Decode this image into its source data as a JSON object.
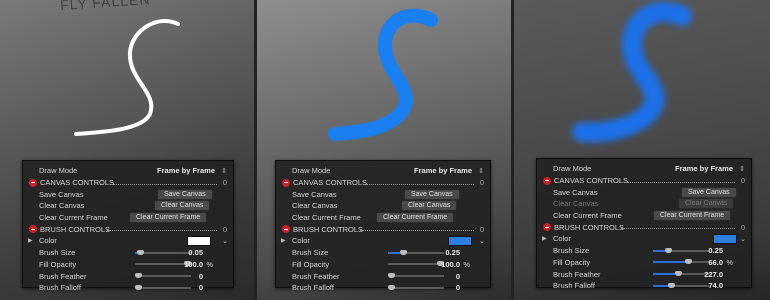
{
  "background": {
    "text": "FLY FALLEN"
  },
  "panels": [
    {
      "stroke_color": "#ffffff",
      "controls": {
        "draw_mode": {
          "label": "Draw Mode",
          "value": "Frame by Frame"
        },
        "canvas_section": {
          "label": "CANVAS CONTROLS",
          "value": "0"
        },
        "save_canvas": {
          "label": "Save Canvas",
          "button": "Save Canvas"
        },
        "clear_canvas": {
          "label": "Clear Canvas",
          "button": "Clear Canvas"
        },
        "clear_frame": {
          "label": "Clear Current Frame",
          "button": "Clear Current Frame"
        },
        "brush_section": {
          "label": "BRUSH CONTROLS",
          "value": "0"
        },
        "color": {
          "label": "Color",
          "value": "#ffffff"
        },
        "brush_size": {
          "label": "Brush Size",
          "value": "0.05"
        },
        "fill_opacity": {
          "label": "Fill Opacity",
          "value": "100.0",
          "unit": "%"
        },
        "brush_feather": {
          "label": "Brush Feather",
          "value": "0"
        },
        "brush_falloff": {
          "label": "Brush Falloff",
          "value": "0"
        }
      },
      "levels": {
        "brush_size": 0.05,
        "fill_opacity": 1.0,
        "brush_feather": 0,
        "brush_falloff": 0
      }
    },
    {
      "stroke_color": "#1a7ff0",
      "controls": {
        "draw_mode": {
          "label": "Draw Mode",
          "value": "Frame by Frame"
        },
        "canvas_section": {
          "label": "CANVAS CONTROLS",
          "value": "0"
        },
        "save_canvas": {
          "label": "Save Canvas",
          "button": "Save Canvas"
        },
        "clear_canvas": {
          "label": "Clear Canvas",
          "button": "Clear Canvas"
        },
        "clear_frame": {
          "label": "Clear Current Frame",
          "button": "Clear Current Frame"
        },
        "brush_section": {
          "label": "BRUSH CONTROLS",
          "value": "0"
        },
        "color": {
          "label": "Color",
          "value": "#2f7fe0"
        },
        "brush_size": {
          "label": "Brush Size",
          "value": "0.25"
        },
        "fill_opacity": {
          "label": "Fill Opacity",
          "value": "100.0",
          "unit": "%"
        },
        "brush_feather": {
          "label": "Brush Feather",
          "value": "0"
        },
        "brush_falloff": {
          "label": "Brush Falloff",
          "value": "0"
        }
      },
      "levels": {
        "brush_size": 0.25,
        "fill_opacity": 1.0,
        "brush_feather": 0,
        "brush_falloff": 0
      }
    },
    {
      "stroke_color": "#1f6fe8",
      "controls": {
        "draw_mode": {
          "label": "Draw Mode",
          "value": "Frame by Frame"
        },
        "canvas_section": {
          "label": "CANVAS CONTROLS",
          "value": "0"
        },
        "save_canvas": {
          "label": "Save Canvas",
          "button": "Save Canvas"
        },
        "clear_canvas": {
          "label": "Clear Canvas",
          "button": "Clear Canvas"
        },
        "clear_frame": {
          "label": "Clear Current Frame",
          "button": "Clear Current Frame"
        },
        "brush_section": {
          "label": "BRUSH CONTROLS",
          "value": "0"
        },
        "color": {
          "label": "Color",
          "value": "#2f7fe0"
        },
        "brush_size": {
          "label": "Brush Size",
          "value": "0.25"
        },
        "fill_opacity": {
          "label": "Fill Opacity",
          "value": "66.0",
          "unit": "%"
        },
        "brush_feather": {
          "label": "Brush Feather",
          "value": "227.0"
        },
        "brush_falloff": {
          "label": "Brush Falloff",
          "value": "74.0"
        }
      },
      "levels": {
        "brush_size": 0.25,
        "fill_opacity": 0.66,
        "brush_feather": 0.45,
        "brush_falloff": 0.3
      }
    }
  ],
  "accent": "#2e6fd8"
}
